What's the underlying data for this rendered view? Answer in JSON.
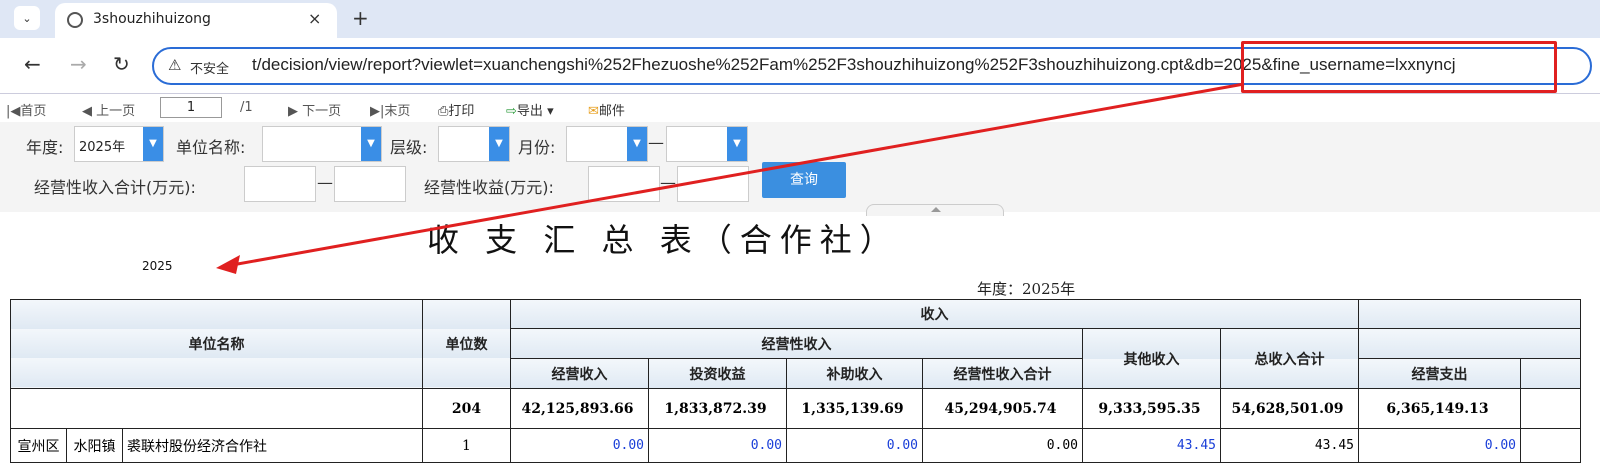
{
  "browser": {
    "tab_title": "3shouzhihuizong",
    "tab_close": "×",
    "new_tab": "+",
    "not_secure": "不安全",
    "url": "t/decision/view/report?viewlet=xuanchengshi%252Fhezuoshe%252Fam%252F3shouzhihuizong%252F3shouzhihuizong.cpt&db=2025&fine_username=lxxnyncj"
  },
  "toolbar": {
    "first": "首页",
    "prev": "上一页",
    "page": "1",
    "total": "/1",
    "next": "下一页",
    "last": "末页",
    "print": "打印",
    "export": "导出",
    "mail": "邮件"
  },
  "filters": {
    "year_label": "年度:",
    "year_value": "2025年",
    "unit_label": "单位名称:",
    "level_label": "层级:",
    "month_label": "月份:",
    "income_label": "经营性收入合计(万元):",
    "profit_label": "经营性收益(万元):",
    "dash": "—",
    "query": "查询"
  },
  "report": {
    "title": "收 支 汇 总 表（合作社）",
    "small_year": "2025",
    "year_text": "年度：2025年",
    "headers": {
      "unit_name": "单位名称",
      "unit_count": "单位数",
      "income": "收入",
      "operating_income": "经营性收入",
      "business_income": "经营收入",
      "investment_income": "投资收益",
      "subsidy_income": "补助收入",
      "operating_total": "经营性收入合计",
      "other_income": "其他收入",
      "total_income": "总收入合计",
      "business_expense": "经营支出"
    },
    "total_row": {
      "count": "204",
      "business_income": "42,125,893.66",
      "investment_income": "1,833,872.39",
      "subsidy_income": "1,335,139.69",
      "operating_total": "45,294,905.74",
      "other_income": "9,333,595.35",
      "total_income": "54,628,501.09",
      "business_expense": "6,365,149.13"
    },
    "rows": [
      {
        "district": "宣州区",
        "town": "水阳镇",
        "name": "裘联村股份经济合作社",
        "count": "1",
        "business_income": "0.00",
        "investment_income": "0.00",
        "subsidy_income": "0.00",
        "operating_total": "0.00",
        "other_income": "43.45",
        "total_income": "43.45",
        "business_expense": "0.00"
      }
    ]
  },
  "colors": {
    "accent": "#3b8fe0",
    "highlight": "#e02020",
    "link_blue": "#1a3fd8"
  }
}
